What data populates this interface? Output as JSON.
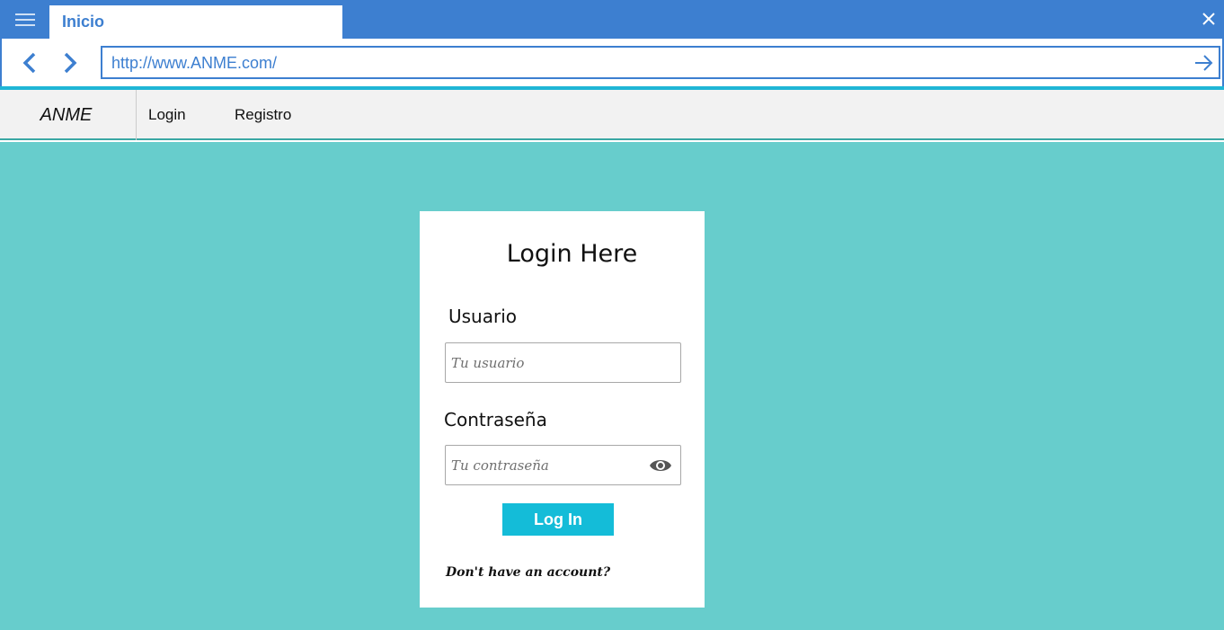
{
  "browser": {
    "tab_title": "Inicio",
    "url": "http://www.ANME.com/",
    "accent_color": "#3d7fd0",
    "icons": {
      "menu": "hamburger-icon",
      "close": "close-icon",
      "back": "chevron-left-icon",
      "forward": "chevron-right-icon",
      "go": "arrow-right-icon"
    }
  },
  "site_nav": {
    "brand": "ANME",
    "links": [
      "Login",
      "Registro"
    ]
  },
  "login_card": {
    "title": "Login Here",
    "user_label": "Usuario",
    "user_placeholder": "Tu usuario",
    "password_label": "Contraseña",
    "password_placeholder": "Tu contraseña",
    "show_password_icon": "eye-icon",
    "submit_label": "Log In",
    "signup_text": "Don't have an account?"
  },
  "colors": {
    "page_background": "#67cdcc",
    "button": "#14bcd8",
    "card": "#ffffff"
  }
}
